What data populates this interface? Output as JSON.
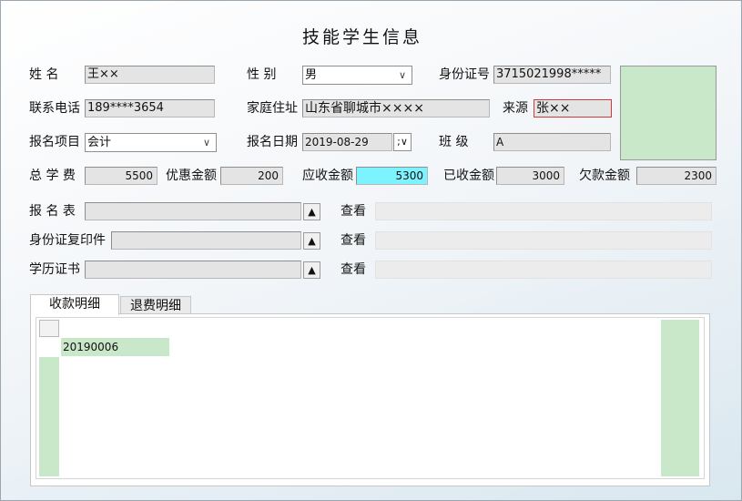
{
  "title": "技能学生信息",
  "row1": {
    "name_label": "姓    名",
    "name_value": "王××",
    "gender_label": "性    别",
    "gender_value": "男",
    "id_label": "身份证号",
    "id_value": "3715021998*****"
  },
  "row2": {
    "phone_label": "联系电话",
    "phone_value": "189****3654",
    "address_label": "家庭住址",
    "address_value": "山东省聊城市××××",
    "source_label": "来源",
    "source_value": "张××"
  },
  "row3": {
    "project_label": "报名项目",
    "project_value": "会计",
    "date_label": "报名日期",
    "date_value": "2019-08-29",
    "class_label": "班    级",
    "class_value": "A"
  },
  "fees": {
    "total_label": "总 学 费",
    "total_value": "5500",
    "discount_label": "优惠金额",
    "discount_value": "200",
    "due_label": "应收金额",
    "due_value": "5300",
    "received_label": "已收金额",
    "received_value": "3000",
    "owed_label": "欠款金额",
    "owed_value": "2300"
  },
  "attachments": [
    {
      "label": "报 名 表",
      "view": "查看"
    },
    {
      "label": "身份证复印件",
      "view": "查看"
    },
    {
      "label": "学历证书",
      "view": "查看"
    }
  ],
  "tabs": [
    {
      "label": "收款明细"
    },
    {
      "label": "退费明细"
    }
  ],
  "grid": {
    "rows": [
      {
        "value": "20190006"
      }
    ]
  },
  "icons": {
    "chevron": "chevron-down-icon",
    "upload": "triangle-up-icon"
  }
}
